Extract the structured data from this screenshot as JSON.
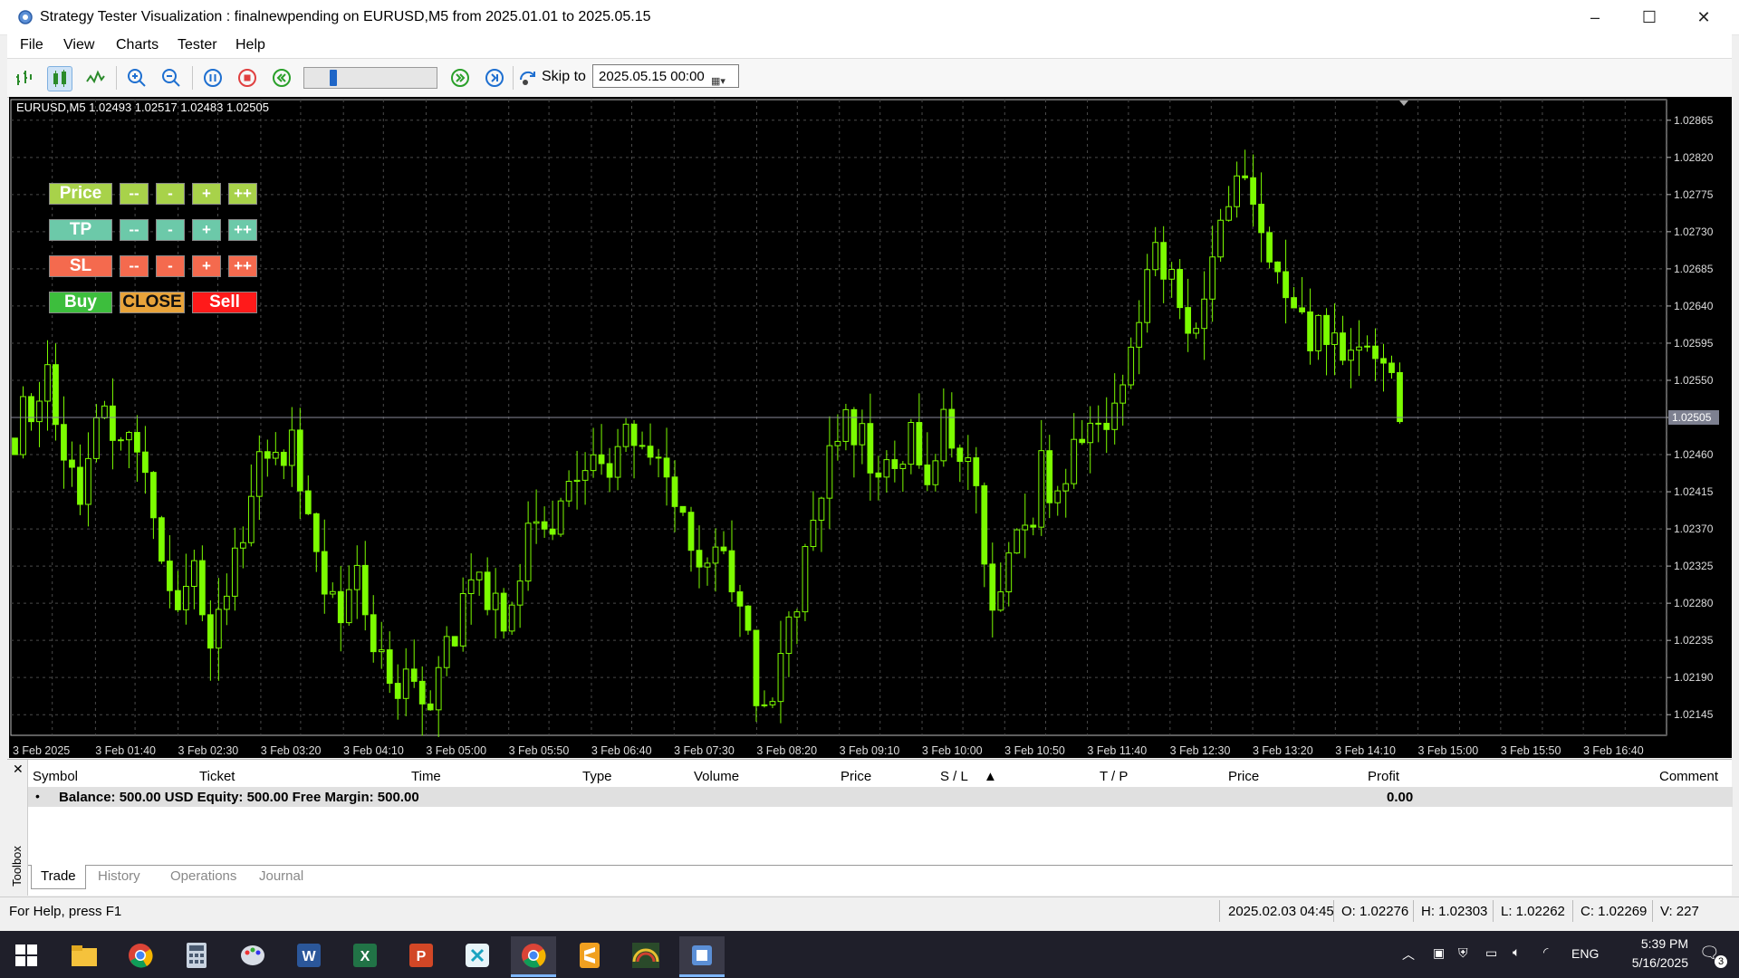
{
  "window": {
    "title": "Strategy Tester Visualization : finalnewpending on EURUSD,M5 from 2025.01.01 to 2025.05.15",
    "controls": [
      "–",
      "☐",
      "✕"
    ]
  },
  "menu": [
    "File",
    "View",
    "Charts",
    "Tester",
    "Help"
  ],
  "toolbar": {
    "skip_label": "Skip to",
    "skip_date": "2025.05.15 00:00",
    "speed_fraction": 0.2
  },
  "chart": {
    "symbol_info": "EURUSD,M5  1.02493 1.02517 1.02483 1.02505",
    "current_price_label": "1.02505",
    "colors": {
      "background": "#000000",
      "candle": "#7CFC00",
      "grid": "#4a4a4a",
      "current": "#8a8a9a"
    }
  },
  "chart_data": {
    "type": "candlestick",
    "ylim": [
      1.0212,
      1.0289
    ],
    "y_ticks": [
      "1.02865",
      "1.02820",
      "1.02775",
      "1.02730",
      "1.02685",
      "1.02640",
      "1.02595",
      "1.02550",
      "1.02505",
      "1.02460",
      "1.02415",
      "1.02370",
      "1.02325",
      "1.02280",
      "1.02235",
      "1.02190",
      "1.02145"
    ],
    "x_ticks": [
      "3 Feb 2025",
      "3 Feb 01:40",
      "3 Feb 02:30",
      "3 Feb 03:20",
      "3 Feb 04:10",
      "3 Feb 05:00",
      "3 Feb 05:50",
      "3 Feb 06:40",
      "3 Feb 07:30",
      "3 Feb 08:20",
      "3 Feb 09:10",
      "3 Feb 10:00",
      "3 Feb 10:50",
      "3 Feb 11:40",
      "3 Feb 12:30",
      "3 Feb 13:20",
      "3 Feb 14:10",
      "3 Feb 15:00",
      "3 Feb 15:50",
      "3 Feb 16:40"
    ],
    "closes": [
      1.0249,
      1.0252,
      1.0255,
      1.0245,
      1.0242,
      1.025,
      1.0248,
      1.0251,
      1.0244,
      1.0236,
      1.0228,
      1.0232,
      1.0225,
      1.0231,
      1.0238,
      1.0244,
      1.0249,
      1.0246,
      1.024,
      1.0232,
      1.0226,
      1.023,
      1.0222,
      1.0218,
      1.022,
      1.0215,
      1.0219,
      1.0225,
      1.0232,
      1.0228,
      1.0226,
      1.0233,
      1.0238,
      1.0236,
      1.0242,
      1.0245,
      1.0244,
      1.0248,
      1.025,
      1.0247,
      1.0244,
      1.024,
      1.0232,
      1.0236,
      1.0228,
      1.0222,
      1.0214,
      1.022,
      1.0228,
      1.0236,
      1.0246,
      1.025,
      1.0248,
      1.0244,
      1.0242,
      1.0248,
      1.0244,
      1.025,
      1.0248,
      1.024,
      1.0228,
      1.0232,
      1.0236,
      1.0244,
      1.0242,
      1.0248,
      1.025,
      1.0248,
      1.0254,
      1.0262,
      1.027,
      1.0268,
      1.0262,
      1.0264,
      1.0276,
      1.0281,
      1.0279,
      1.0272,
      1.0266,
      1.0263,
      1.026,
      1.0261,
      1.0258,
      1.026,
      1.0256,
      1.025
    ],
    "current_price": 1.02505
  },
  "panel": {
    "rows": [
      {
        "label": "Price",
        "buttons": [
          "--",
          "-",
          "+",
          "++"
        ],
        "label_color": "#a8d24a",
        "btn_color": "#a8d24a"
      },
      {
        "label": "TP",
        "buttons": [
          "--",
          "-",
          "+",
          "++"
        ],
        "label_color": "#6cc9a9",
        "btn_color": "#6cc9a9"
      },
      {
        "label": "SL",
        "buttons": [
          "--",
          "-",
          "+",
          "++"
        ],
        "label_color": "#f46a4e",
        "btn_color": "#f46a4e"
      }
    ],
    "buy": "Buy",
    "close": "CLOSE",
    "sell": "Sell",
    "colors": {
      "buy": "#3dbe3d",
      "close": "#e8a33a",
      "sell": "#ff1a1a"
    }
  },
  "toolbox": {
    "side_label": "Toolbox",
    "columns": [
      "Symbol",
      "Ticket",
      "Time",
      "Type",
      "Volume",
      "Price",
      "S / L",
      "T / P",
      "Price",
      "Profit",
      "Comment"
    ],
    "balance_line": "Balance: 500.00 USD  Equity: 500.00  Free Margin: 500.00",
    "profit": "0.00",
    "tabs": [
      "Trade",
      "History",
      "Operations",
      "Journal"
    ]
  },
  "statusbar": {
    "help": "For Help, press F1",
    "datetime": "2025.02.03 04:45",
    "open": "O: 1.02276",
    "high": "H: 1.02303",
    "low": "L: 1.02262",
    "close": "C: 1.02269",
    "volume": "V: 227"
  },
  "taskbar": {
    "lang": "ENG",
    "time": "5:39 PM",
    "date": "5/16/2025",
    "notif_count": "3"
  }
}
